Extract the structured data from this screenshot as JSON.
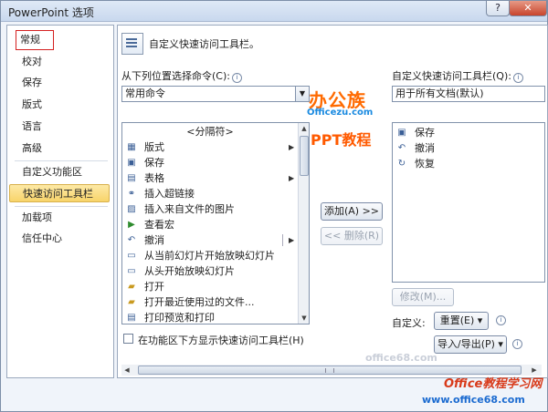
{
  "window": {
    "title": "PowerPoint 选项",
    "help_label": "?",
    "close_label": "✕"
  },
  "nav": {
    "items": [
      {
        "label": "常规"
      },
      {
        "label": "校对"
      },
      {
        "label": "保存"
      },
      {
        "label": "版式"
      },
      {
        "label": "语言"
      },
      {
        "label": "高级"
      },
      {
        "label": "自定义功能区"
      },
      {
        "label": "快速访问工具栏"
      },
      {
        "label": "加载项"
      },
      {
        "label": "信任中心"
      }
    ],
    "selected": "快速访问工具栏",
    "highlighted": "常规"
  },
  "content": {
    "heading": "自定义快速访问工具栏。",
    "choose_label": "从下列位置选择命令(C):",
    "choose_value": "常用命令",
    "customize_label": "自定义快速访问工具栏(Q):",
    "customize_value": "用于所有文档(默认)",
    "commands": [
      {
        "label": "<分隔符>",
        "icon": "separator"
      },
      {
        "label": "版式",
        "icon": "layout-icon",
        "submenu": true
      },
      {
        "label": "保存",
        "icon": "save-icon"
      },
      {
        "label": "表格",
        "icon": "table-icon",
        "submenu": true
      },
      {
        "label": "插入超链接",
        "icon": "hyperlink-icon"
      },
      {
        "label": "插入来自文件的图片",
        "icon": "picture-icon"
      },
      {
        "label": "查看宏",
        "icon": "macro-icon"
      },
      {
        "label": "撤消",
        "icon": "undo-icon",
        "splitter": true
      },
      {
        "label": "从当前幻灯片开始放映幻灯片",
        "icon": "slideshow-current-icon"
      },
      {
        "label": "从头开始放映幻灯片",
        "icon": "slideshow-start-icon"
      },
      {
        "label": "打开",
        "icon": "open-icon"
      },
      {
        "label": "打开最近使用过的文件...",
        "icon": "recent-files-icon"
      },
      {
        "label": "打印预览和打印",
        "icon": "print-preview-icon"
      }
    ],
    "toolbar_items": [
      {
        "label": "保存",
        "icon": "save-icon"
      },
      {
        "label": "撤消",
        "icon": "undo-icon"
      },
      {
        "label": "恢复",
        "icon": "redo-icon"
      }
    ],
    "add_button": "添加(A) >>",
    "remove_button": "<< 删除(R)",
    "modify_button": "修改(M)...",
    "customize_text": "自定义:",
    "reset_button": "重置(E) ▾",
    "import_export_button": "导入/导出(P) ▾",
    "below_ribbon_checkbox": "在功能区下方显示快速访问工具栏(H)",
    "below_ribbon_checked": false
  },
  "watermarks": {
    "logo_text": "办公族",
    "logo_url": "Officezu.com",
    "ppt_text": "PPT教程",
    "site_text": "Office教程学习网",
    "site_url": "www.office68.com",
    "faint_text": "office68.com"
  },
  "colors": {
    "accent_selected": "#f8d46a",
    "outline_red": "#d42020",
    "close_red": "#c8442c"
  }
}
